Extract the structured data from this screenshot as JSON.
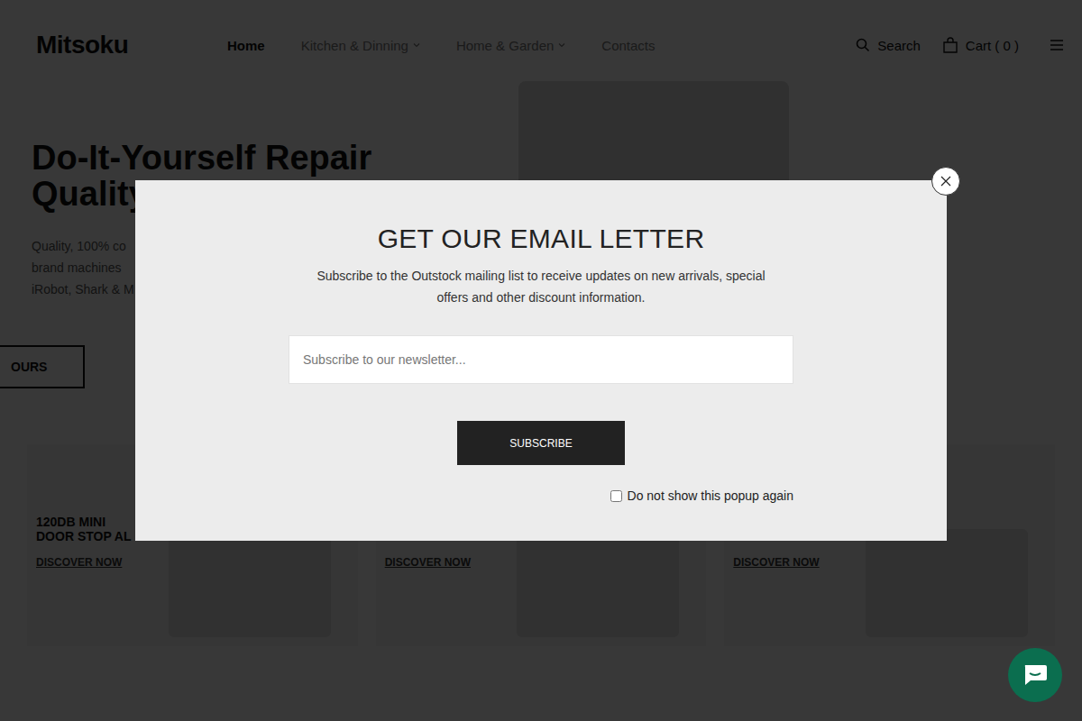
{
  "header": {
    "logo": "Mitsoku",
    "nav": [
      {
        "label": "Home",
        "selected": true,
        "dropdown": false
      },
      {
        "label": "Kitchen & Dinning",
        "selected": false,
        "dropdown": true
      },
      {
        "label": "Home & Garden",
        "selected": false,
        "dropdown": true
      },
      {
        "label": "Contacts",
        "selected": false,
        "dropdown": false
      }
    ],
    "search": "Search",
    "cart": "Cart ( 0 )"
  },
  "hero": {
    "title": [
      "Do-It-Yourself Repair",
      "Quality"
    ],
    "description": [
      "Quality, 100% co",
      "brand machines",
      "iRobot, Shark & M"
    ],
    "button": "OURS"
  },
  "banners": [
    {
      "title": [
        "120DB MINI",
        "DOOR STOP AL"
      ],
      "link": "DISCOVER NOW"
    },
    {
      "title": [],
      "link": "DISCOVER NOW"
    },
    {
      "title": [],
      "link": "DISCOVER NOW"
    }
  ],
  "modal": {
    "title": "GET OUR EMAIL LETTER",
    "description": "Subscribe to the Outstock mailing list to receive updates on new arrivals, special offers and other discount information.",
    "input": {
      "placeholder": "Subscribe to our newsletter..."
    },
    "button": "SUBSCRIBE",
    "checkbox": {
      "label": "Do not show this popup again",
      "checked": false
    }
  }
}
